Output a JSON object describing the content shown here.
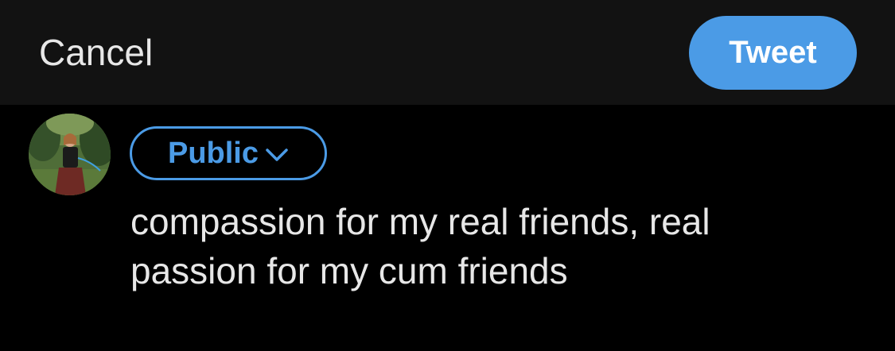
{
  "header": {
    "cancel_label": "Cancel",
    "tweet_label": "Tweet"
  },
  "composer": {
    "audience_label": "Public",
    "text_lines": [
      "compassion for my real friends, real",
      "passion for my cum friends"
    ]
  },
  "icons": {
    "audience_dropdown": "chevron-down-icon",
    "avatar": "avatar"
  },
  "colors": {
    "background": "#000000",
    "header_background": "#121212",
    "accent": "#4b9be6",
    "text": "#e7e7e7"
  }
}
